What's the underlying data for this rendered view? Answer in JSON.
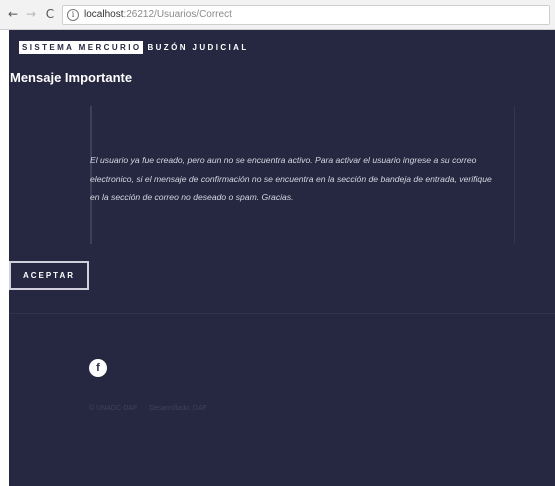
{
  "browser": {
    "back_icon": "←",
    "forward_icon": "→",
    "reload_icon": "C",
    "info_icon": "i",
    "url_host": "localhost",
    "url_rest": ":26212/Usuarios/Correct"
  },
  "brand": {
    "primary": "SISTEMA MERCURIO",
    "secondary": "BUZÓN JUDICIAL"
  },
  "main": {
    "title": "Mensaje Importante",
    "message": "El usuario ya fue creado, pero aun no se encuentra activo. Para activar el usuario ingrese a su correo electronico, si el mensaje de confirmación no se encuentra en la sección de bandeja de entrada, verifique en la sección de correo no deseado o spam. Gracias.",
    "accept_label": "ACEPTAR"
  },
  "footer": {
    "facebook_icon": "f",
    "copyright": "© UNADC-DAF",
    "developed_by": "Desarrollado: DAF"
  },
  "colors": {
    "page_bg": "#262841",
    "text": "#ffffff",
    "message_text": "#d6d6e0"
  }
}
